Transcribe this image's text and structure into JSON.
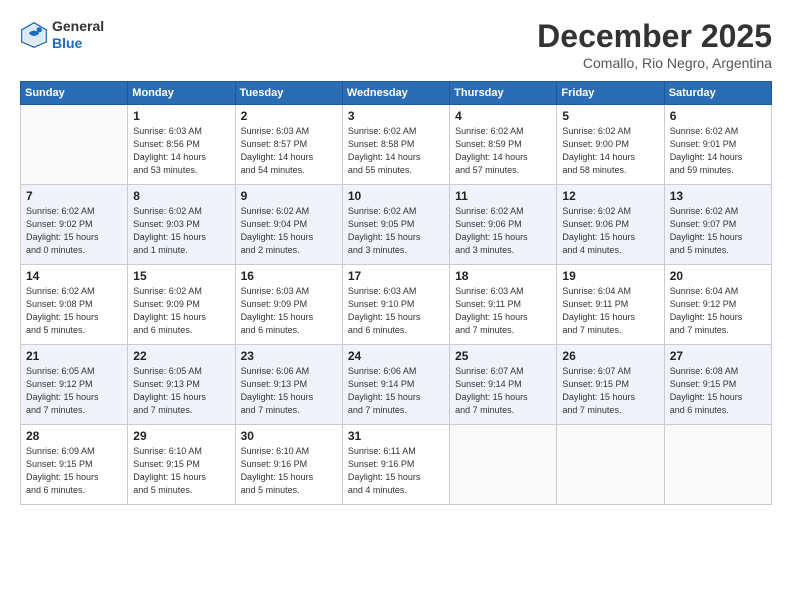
{
  "header": {
    "logo_line1": "General",
    "logo_line2": "Blue",
    "month": "December 2025",
    "location": "Comallo, Rio Negro, Argentina"
  },
  "days_of_week": [
    "Sunday",
    "Monday",
    "Tuesday",
    "Wednesday",
    "Thursday",
    "Friday",
    "Saturday"
  ],
  "weeks": [
    [
      {
        "day": "",
        "info": ""
      },
      {
        "day": "1",
        "info": "Sunrise: 6:03 AM\nSunset: 8:56 PM\nDaylight: 14 hours\nand 53 minutes."
      },
      {
        "day": "2",
        "info": "Sunrise: 6:03 AM\nSunset: 8:57 PM\nDaylight: 14 hours\nand 54 minutes."
      },
      {
        "day": "3",
        "info": "Sunrise: 6:02 AM\nSunset: 8:58 PM\nDaylight: 14 hours\nand 55 minutes."
      },
      {
        "day": "4",
        "info": "Sunrise: 6:02 AM\nSunset: 8:59 PM\nDaylight: 14 hours\nand 57 minutes."
      },
      {
        "day": "5",
        "info": "Sunrise: 6:02 AM\nSunset: 9:00 PM\nDaylight: 14 hours\nand 58 minutes."
      },
      {
        "day": "6",
        "info": "Sunrise: 6:02 AM\nSunset: 9:01 PM\nDaylight: 14 hours\nand 59 minutes."
      }
    ],
    [
      {
        "day": "7",
        "info": "Sunrise: 6:02 AM\nSunset: 9:02 PM\nDaylight: 15 hours\nand 0 minutes."
      },
      {
        "day": "8",
        "info": "Sunrise: 6:02 AM\nSunset: 9:03 PM\nDaylight: 15 hours\nand 1 minute."
      },
      {
        "day": "9",
        "info": "Sunrise: 6:02 AM\nSunset: 9:04 PM\nDaylight: 15 hours\nand 2 minutes."
      },
      {
        "day": "10",
        "info": "Sunrise: 6:02 AM\nSunset: 9:05 PM\nDaylight: 15 hours\nand 3 minutes."
      },
      {
        "day": "11",
        "info": "Sunrise: 6:02 AM\nSunset: 9:06 PM\nDaylight: 15 hours\nand 3 minutes."
      },
      {
        "day": "12",
        "info": "Sunrise: 6:02 AM\nSunset: 9:06 PM\nDaylight: 15 hours\nand 4 minutes."
      },
      {
        "day": "13",
        "info": "Sunrise: 6:02 AM\nSunset: 9:07 PM\nDaylight: 15 hours\nand 5 minutes."
      }
    ],
    [
      {
        "day": "14",
        "info": "Sunrise: 6:02 AM\nSunset: 9:08 PM\nDaylight: 15 hours\nand 5 minutes."
      },
      {
        "day": "15",
        "info": "Sunrise: 6:02 AM\nSunset: 9:09 PM\nDaylight: 15 hours\nand 6 minutes."
      },
      {
        "day": "16",
        "info": "Sunrise: 6:03 AM\nSunset: 9:09 PM\nDaylight: 15 hours\nand 6 minutes."
      },
      {
        "day": "17",
        "info": "Sunrise: 6:03 AM\nSunset: 9:10 PM\nDaylight: 15 hours\nand 6 minutes."
      },
      {
        "day": "18",
        "info": "Sunrise: 6:03 AM\nSunset: 9:11 PM\nDaylight: 15 hours\nand 7 minutes."
      },
      {
        "day": "19",
        "info": "Sunrise: 6:04 AM\nSunset: 9:11 PM\nDaylight: 15 hours\nand 7 minutes."
      },
      {
        "day": "20",
        "info": "Sunrise: 6:04 AM\nSunset: 9:12 PM\nDaylight: 15 hours\nand 7 minutes."
      }
    ],
    [
      {
        "day": "21",
        "info": "Sunrise: 6:05 AM\nSunset: 9:12 PM\nDaylight: 15 hours\nand 7 minutes."
      },
      {
        "day": "22",
        "info": "Sunrise: 6:05 AM\nSunset: 9:13 PM\nDaylight: 15 hours\nand 7 minutes."
      },
      {
        "day": "23",
        "info": "Sunrise: 6:06 AM\nSunset: 9:13 PM\nDaylight: 15 hours\nand 7 minutes."
      },
      {
        "day": "24",
        "info": "Sunrise: 6:06 AM\nSunset: 9:14 PM\nDaylight: 15 hours\nand 7 minutes."
      },
      {
        "day": "25",
        "info": "Sunrise: 6:07 AM\nSunset: 9:14 PM\nDaylight: 15 hours\nand 7 minutes."
      },
      {
        "day": "26",
        "info": "Sunrise: 6:07 AM\nSunset: 9:15 PM\nDaylight: 15 hours\nand 7 minutes."
      },
      {
        "day": "27",
        "info": "Sunrise: 6:08 AM\nSunset: 9:15 PM\nDaylight: 15 hours\nand 6 minutes."
      }
    ],
    [
      {
        "day": "28",
        "info": "Sunrise: 6:09 AM\nSunset: 9:15 PM\nDaylight: 15 hours\nand 6 minutes."
      },
      {
        "day": "29",
        "info": "Sunrise: 6:10 AM\nSunset: 9:15 PM\nDaylight: 15 hours\nand 5 minutes."
      },
      {
        "day": "30",
        "info": "Sunrise: 6:10 AM\nSunset: 9:16 PM\nDaylight: 15 hours\nand 5 minutes."
      },
      {
        "day": "31",
        "info": "Sunrise: 6:11 AM\nSunset: 9:16 PM\nDaylight: 15 hours\nand 4 minutes."
      },
      {
        "day": "",
        "info": ""
      },
      {
        "day": "",
        "info": ""
      },
      {
        "day": "",
        "info": ""
      }
    ]
  ]
}
